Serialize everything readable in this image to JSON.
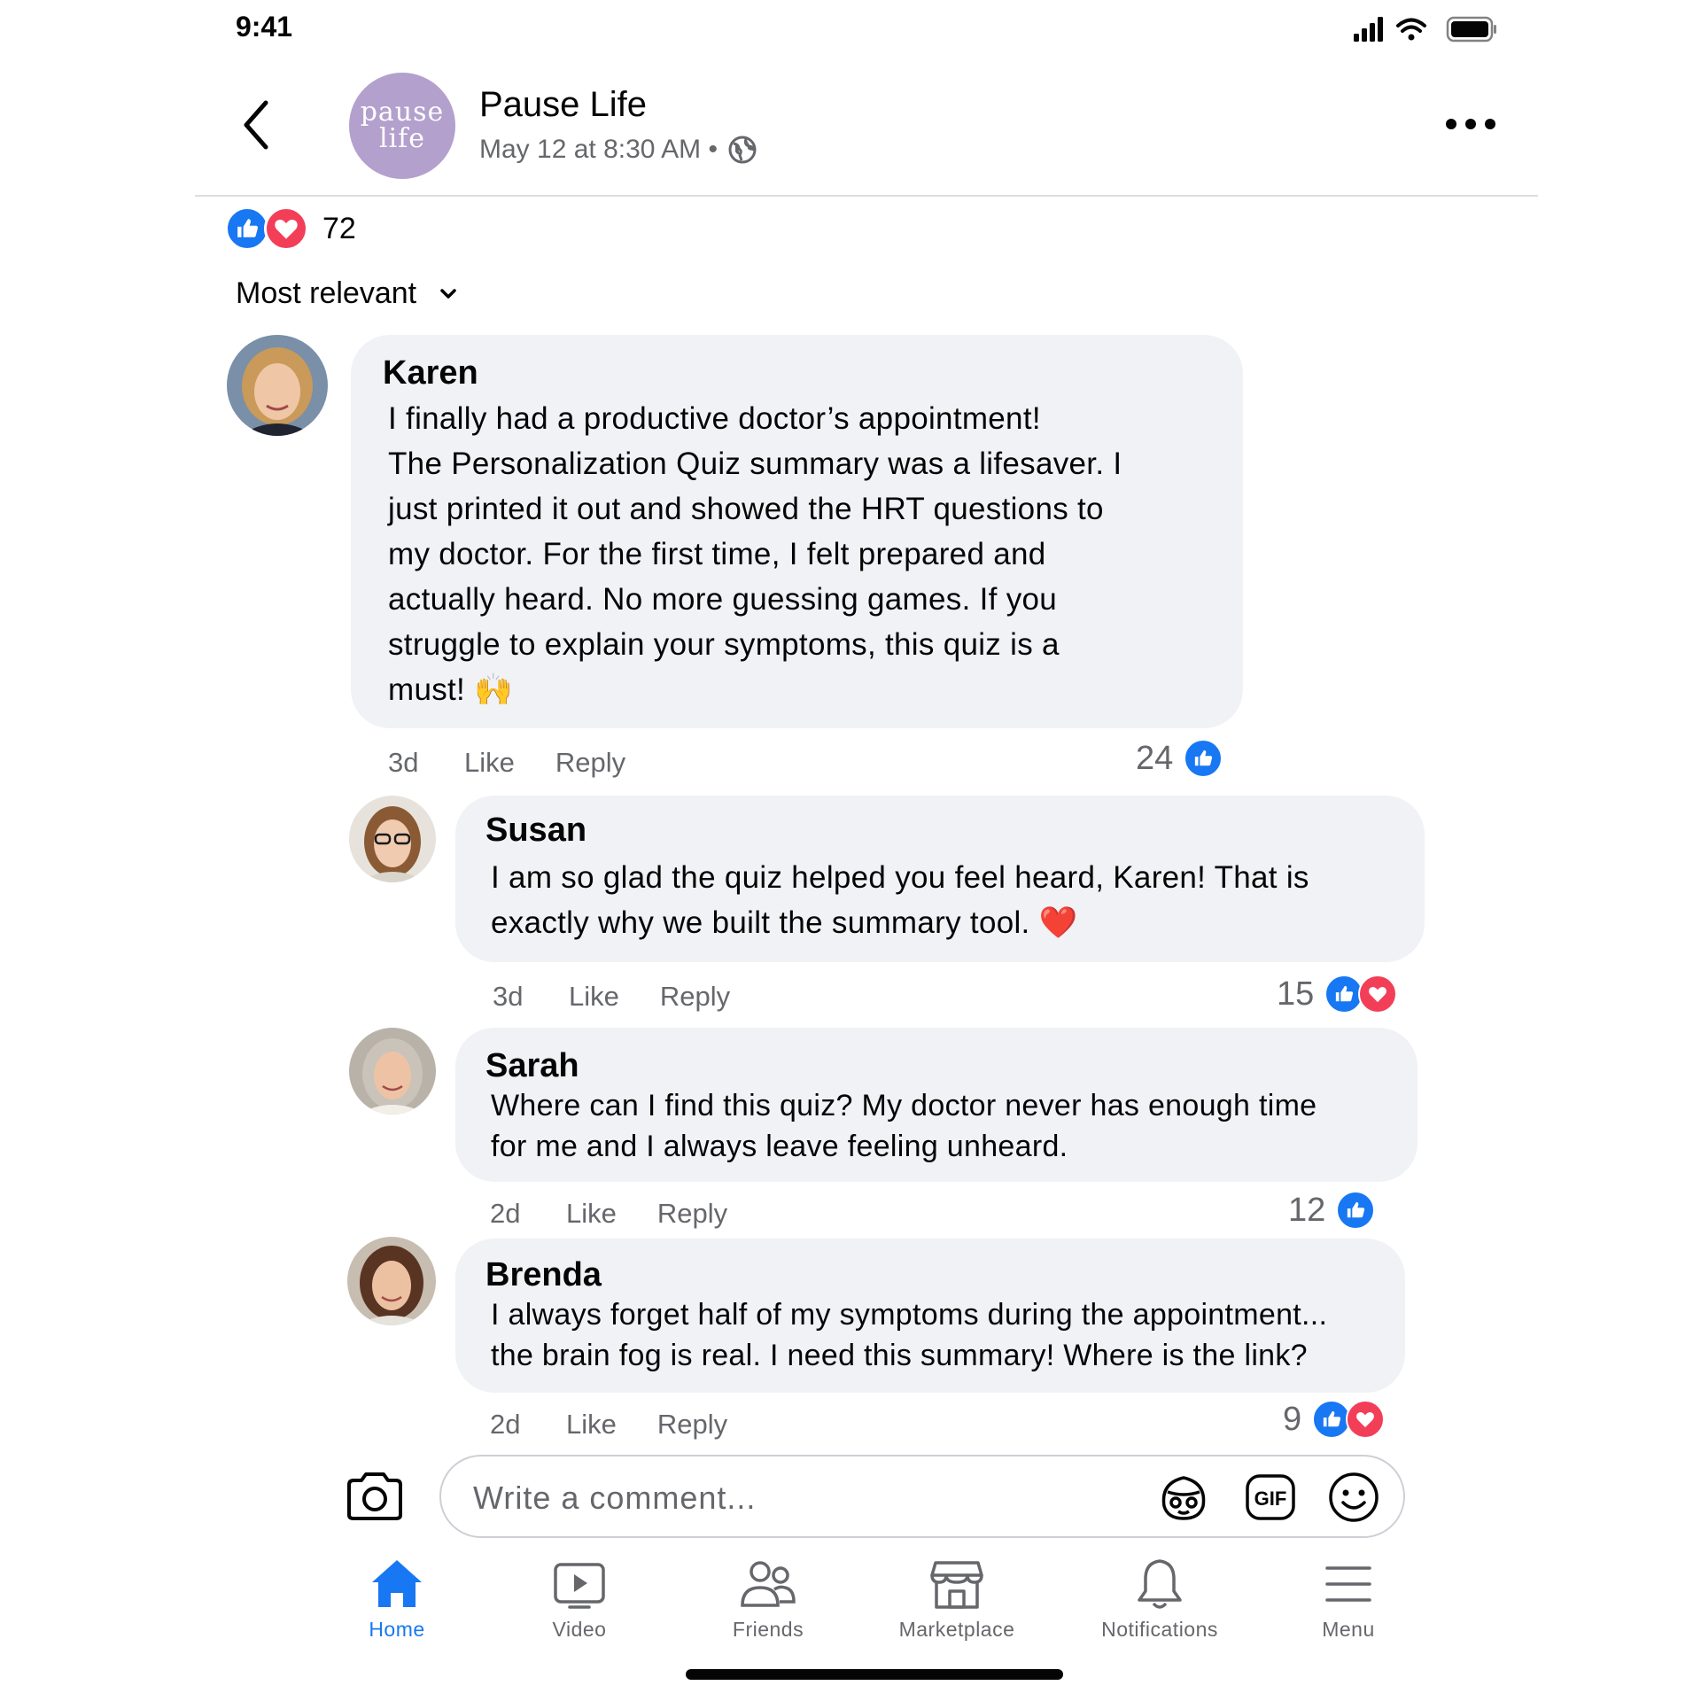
{
  "status_bar": {
    "time": "9:41"
  },
  "post": {
    "page_name": "Pause Life",
    "avatar_text": [
      "pause",
      "life"
    ],
    "meta": "May 12 at 8:30 AM •",
    "audience_icon": "globe-icon",
    "reactions": {
      "icons": [
        "like",
        "love"
      ],
      "count": "72"
    }
  },
  "sort": {
    "label": "Most relevant"
  },
  "comments": [
    {
      "author": "Karen",
      "text": "I finally had a productive doctor’s appointment!\nThe Personalization Quiz summary was a lifesaver. I\njust printed it out and showed the HRT questions to\nmy doctor. For the first time, I felt prepared and\nactually heard. No more guessing games. If you\nstruggle to explain your symptoms, this quiz is a\nmust! 🙌",
      "time": "3d",
      "like_label": "Like",
      "reply_label": "Reply",
      "reaction_count": "24",
      "reactions": [
        "like"
      ]
    },
    {
      "author": "Susan",
      "text": "I am so glad the quiz helped you feel heard, Karen! That is\nexactly why we built the summary tool. ❤️",
      "time": "3d",
      "like_label": "Like",
      "reply_label": "Reply",
      "reaction_count": "15",
      "reactions": [
        "like",
        "love"
      ]
    },
    {
      "author": "Sarah",
      "text": "Where can I find this quiz? My doctor never has enough time\nfor me and I always leave feeling unheard.",
      "time": "2d",
      "like_label": "Like",
      "reply_label": "Reply",
      "reaction_count": "12",
      "reactions": [
        "like"
      ]
    },
    {
      "author": "Brenda",
      "text": "I always forget half of my symptoms during the appointment...\nthe brain fog is real. I need this summary! Where is the link?",
      "time": "2d",
      "like_label": "Like",
      "reply_label": "Reply",
      "reaction_count": "9",
      "reactions": [
        "like",
        "love"
      ]
    }
  ],
  "composer": {
    "placeholder": "Write a comment..."
  },
  "nav": [
    {
      "label": "Home",
      "icon": "home-icon",
      "active": true
    },
    {
      "label": "Video",
      "icon": "video-icon"
    },
    {
      "label": "Friends",
      "icon": "friends-icon"
    },
    {
      "label": "Marketplace",
      "icon": "marketplace-icon"
    },
    {
      "label": "Notifications",
      "icon": "bell-icon"
    },
    {
      "label": "Menu",
      "icon": "menu-icon"
    }
  ],
  "colors": {
    "accent": "#1877f2",
    "love": "#f33e58",
    "bubble": "#f0f2f5",
    "secondary_text": "#65676b",
    "page_avatar": "#b3a0cc"
  }
}
